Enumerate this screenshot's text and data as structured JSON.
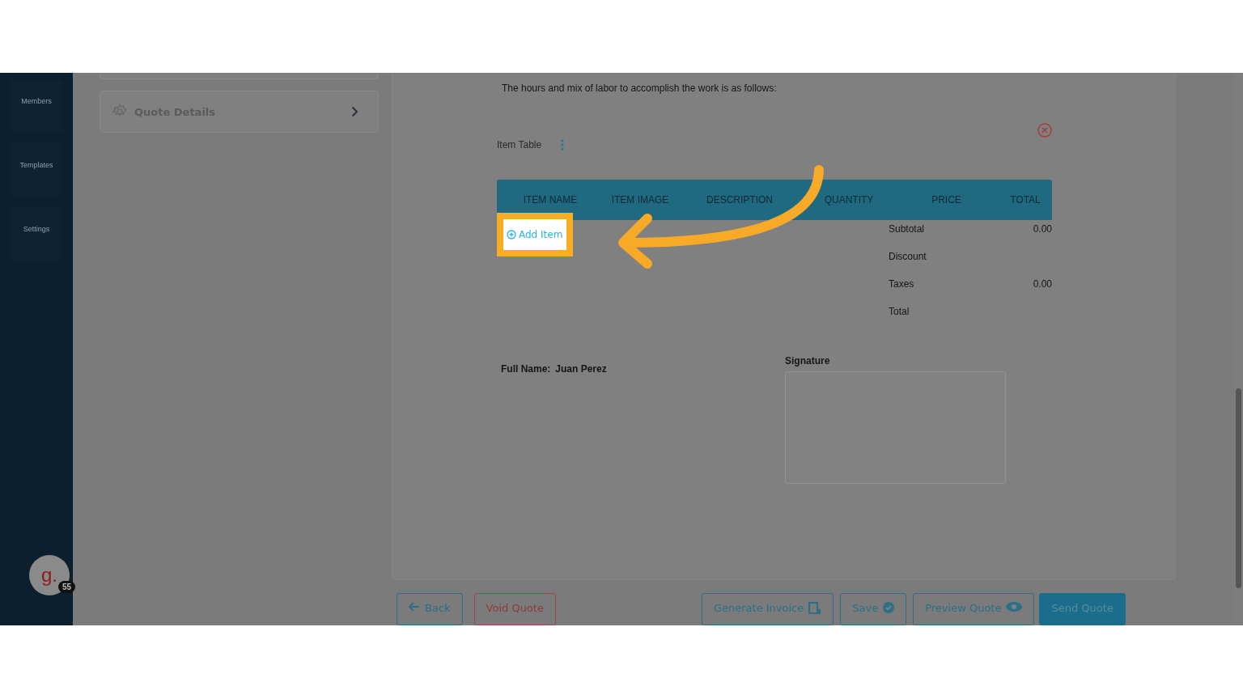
{
  "sidebar": {
    "items": [
      {
        "label": "Members"
      },
      {
        "label": "Templates"
      },
      {
        "label": "Settings"
      }
    ],
    "avatar": {
      "letter": "g.",
      "badge": "55"
    }
  },
  "panel": {
    "title": "Quote Details"
  },
  "document": {
    "intro": "The hours and mix of labor to accomplish the work is as follows:",
    "item_table": {
      "label": "Item Table",
      "columns": [
        "ITEM NAME",
        "ITEM IMAGE",
        "DESCRIPTION",
        "QUANTITY",
        "PRICE",
        "TOTAL"
      ],
      "add_item": "Add Item"
    },
    "totals": [
      {
        "label": "Subtotal",
        "value": "0.00"
      },
      {
        "label": "Discount"
      },
      {
        "label": "Taxes",
        "value": "0.00"
      },
      {
        "label": "Total"
      }
    ],
    "full_name": {
      "label": "Full Name:",
      "value": "Juan Perez"
    },
    "signature": {
      "label": "Signature"
    }
  },
  "buttons": [
    {
      "label": "Back",
      "kind": "outline"
    },
    {
      "label": "Void Quote",
      "kind": "danger"
    },
    {
      "label": "Generate Invoice",
      "kind": "outline"
    },
    {
      "label": "Save",
      "kind": "outline"
    },
    {
      "label": "Preview Quote",
      "kind": "outline"
    },
    {
      "label": "Send Quote",
      "kind": "primary"
    }
  ]
}
